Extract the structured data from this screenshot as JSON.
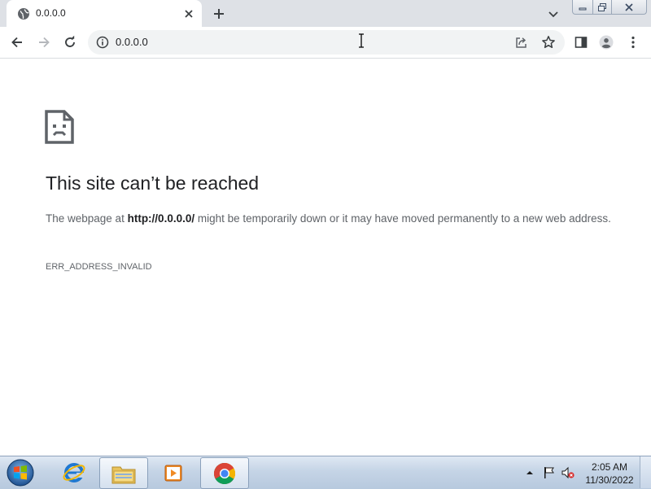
{
  "browser": {
    "tab": {
      "title": "0.0.0.0",
      "favicon": "globe-icon"
    },
    "window_controls": [
      "minimize-icon",
      "restore-icon",
      "close-icon"
    ],
    "toolbar": {
      "back": "arrow-left-icon",
      "forward": "arrow-right-icon",
      "reload": "reload-icon",
      "address_text": "0.0.0.0",
      "share": "share-icon",
      "bookmark": "star-icon",
      "side_panel": "side-panel-icon",
      "profile": "profile-icon",
      "menu": "kebab-menu-icon"
    }
  },
  "error_page": {
    "icon": "sad-page-icon",
    "title": "This site can’t be reached",
    "body_prefix": "The webpage at ",
    "body_url": "http://0.0.0.0/",
    "body_suffix": " might be temporarily down or it may have moved permanently to a new web address.",
    "error_code": "ERR_ADDRESS_INVALID"
  },
  "taskbar": {
    "items": [
      "start-orb-icon",
      "internet-explorer-icon",
      "file-explorer-icon",
      "media-player-icon",
      "chrome-icon"
    ],
    "tray": [
      "show-hidden-icons-icon",
      "action-center-flag-icon",
      "volume-muted-icon"
    ],
    "clock_time": "2:05 AM",
    "clock_date": "11/30/2022"
  },
  "colors": {
    "tabstrip_bg": "#dee1e6",
    "omnibox_bg": "#f1f3f4",
    "title_text": "#202124",
    "body_text": "#5f6368"
  }
}
